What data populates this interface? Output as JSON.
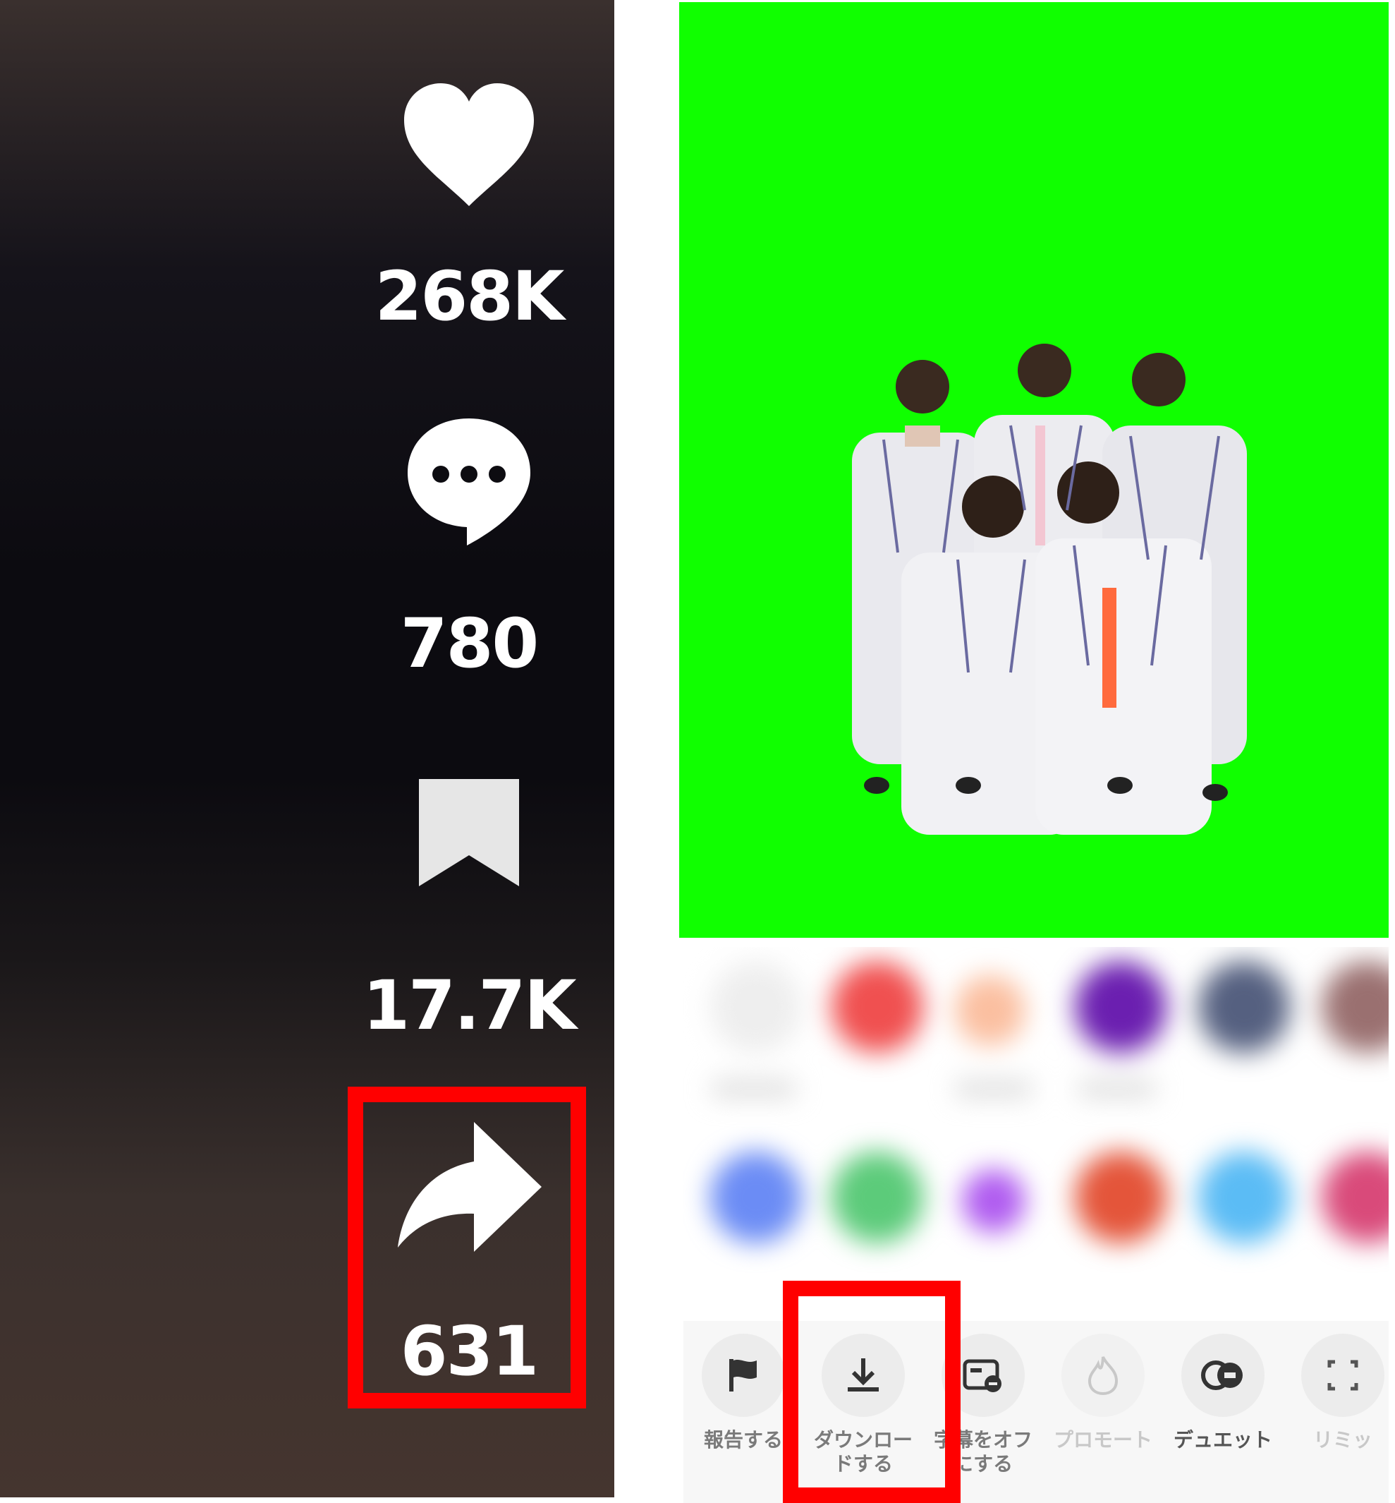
{
  "rail": {
    "like_count": "268K",
    "comment_count": "780",
    "favorite_count": "17.7K",
    "share_count": "631",
    "icons": [
      "heart-icon",
      "comment-icon",
      "bookmark-icon",
      "share-icon"
    ]
  },
  "share_sheet": {
    "actions": [
      {
        "label": "報告する",
        "icon": "flag-icon"
      },
      {
        "label_line1": "ダウンロー",
        "label_line2": "ドする",
        "icon": "download-icon"
      },
      {
        "label_line1": "字幕をオフ",
        "label_line2": "にする",
        "icon": "captions-off-icon"
      },
      {
        "label": "プロモート",
        "icon": "flame-icon"
      },
      {
        "label": "デュエット",
        "icon": "duet-icon"
      },
      {
        "label": "リミッ",
        "icon": "stitch-icon"
      }
    ]
  },
  "colors": {
    "highlight": "#ff0000",
    "chroma_green": "#10ff00"
  }
}
